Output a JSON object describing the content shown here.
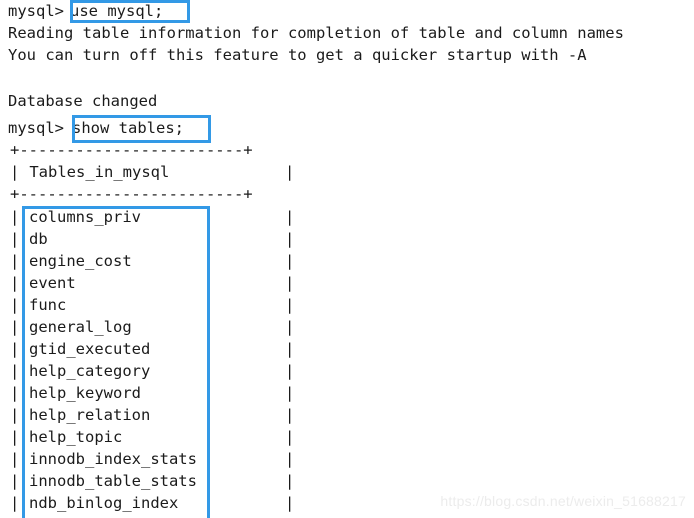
{
  "terminal": {
    "prompt": "mysql>",
    "commands": {
      "use_db": "use mysql;",
      "show_tables": "show tables;"
    },
    "messages": {
      "reading_table_info": "Reading table information for completion of table and column names",
      "turn_off_feature": "You can turn off this feature to get a quicker startup with -A",
      "database_changed": "Database changed"
    },
    "result_table": {
      "separator": "+------------------------+",
      "column_header": "Tables_in_mysql",
      "left_pipe": "|",
      "right_pipe": "|",
      "rows": [
        "columns_priv",
        "db",
        "engine_cost",
        "event",
        "func",
        "general_log",
        "gtid_executed",
        "help_category",
        "help_keyword",
        "help_relation",
        "help_topic",
        "innodb_index_stats",
        "innodb_table_stats",
        "ndb_binlog_index"
      ]
    }
  },
  "annotations": {
    "box_color": "#3399e6",
    "boxes": [
      {
        "name": "use-mysql-command",
        "label": "use mysql;"
      },
      {
        "name": "show-tables-command",
        "label": "show tables;"
      },
      {
        "name": "table-names-list",
        "label": "table name column values"
      }
    ]
  },
  "watermark": {
    "text": "https://blog.csdn.net/weixin_51688217",
    "color": "#ececec"
  }
}
